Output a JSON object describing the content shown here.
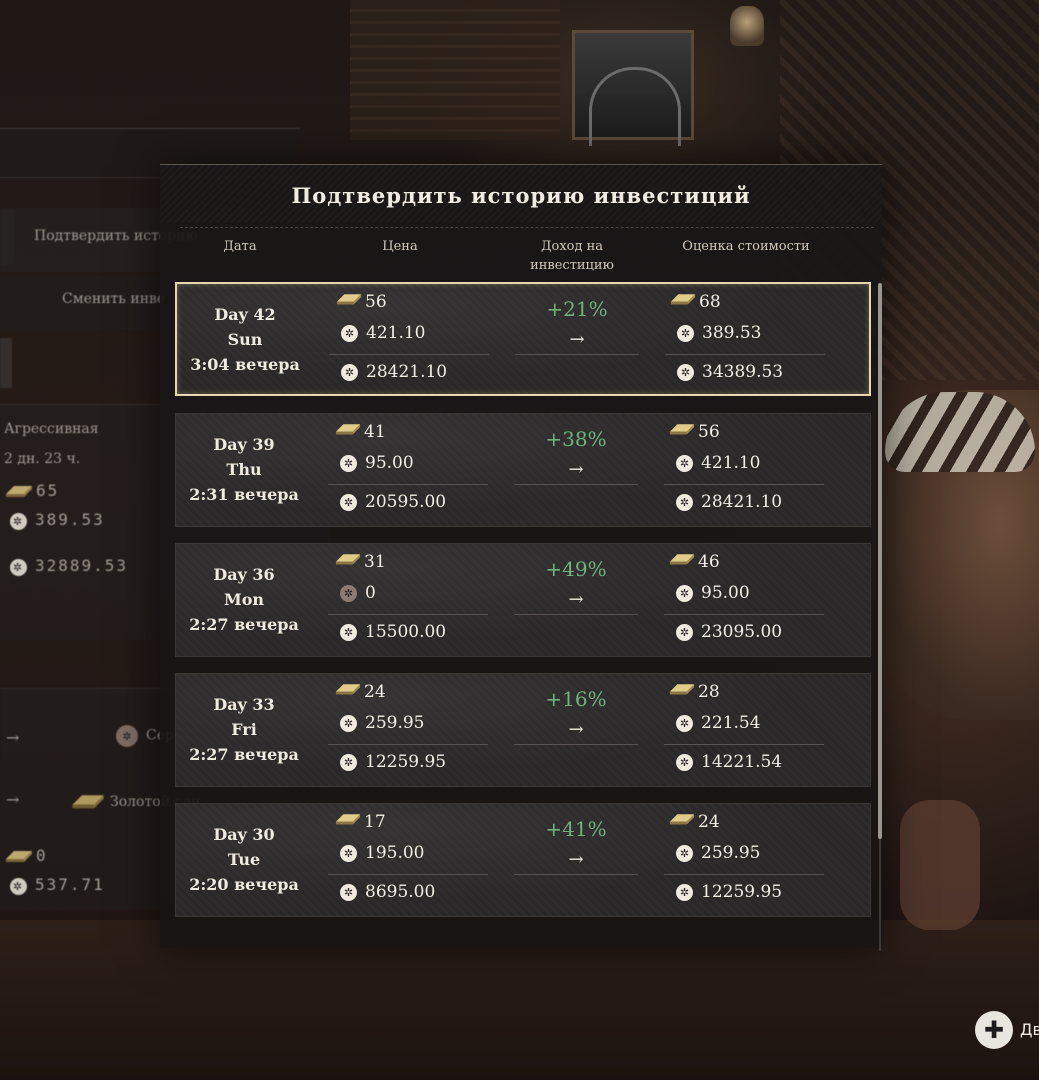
{
  "dialog": {
    "title": "Подтвердить историю инвестиций",
    "columns": {
      "date": "Дата",
      "price": "Цена",
      "roi_line1": "Доход на",
      "roi_line2": "инвестицию",
      "valuation": "Оценка стоимости"
    },
    "rows": [
      {
        "day": "Day 42",
        "weekday": "Sun",
        "time": "3:04 вечера",
        "gold_in": "56",
        "price_unit": "421.10",
        "price_total": "28421.10",
        "roi": "+21%",
        "arrow": "→",
        "gold_out": "68",
        "value_unit": "389.53",
        "value_total": "34389.53"
      },
      {
        "day": "Day 39",
        "weekday": "Thu",
        "time": "2:31 вечера",
        "gold_in": "41",
        "price_unit": "95.00",
        "price_total": "20595.00",
        "roi": "+38%",
        "arrow": "→",
        "gold_out": "56",
        "value_unit": "421.10",
        "value_total": "28421.10"
      },
      {
        "day": "Day 36",
        "weekday": "Mon",
        "time": "2:27 вечера",
        "gold_in": "31",
        "price_unit": "0",
        "price_total": "15500.00",
        "roi": "+49%",
        "arrow": "→",
        "gold_out": "46",
        "value_unit": "95.00",
        "value_total": "23095.00"
      },
      {
        "day": "Day 33",
        "weekday": "Fri",
        "time": "2:27 вечера",
        "gold_in": "24",
        "price_unit": "259.95",
        "price_total": "12259.95",
        "roi": "+16%",
        "arrow": "→",
        "gold_out": "28",
        "value_unit": "221.54",
        "value_total": "14221.54"
      },
      {
        "day": "Day 30",
        "weekday": "Tue",
        "time": "2:20 вечера",
        "gold_in": "17",
        "price_unit": "195.00",
        "price_total": "8695.00",
        "roi": "+41%",
        "arrow": "→",
        "gold_out": "24",
        "value_unit": "259.95",
        "value_total": "12259.95"
      }
    ]
  },
  "side_panel": {
    "confirm_history": "Подтвердить историю",
    "change_investment": "Сменить инве",
    "strategy": "Агрессивная",
    "time_left": "2 дн. 23 ч.",
    "gold_amount": "65",
    "unit_price": "389.53",
    "total_value": "32889.53",
    "arrow1": "→",
    "silver_label": "Сер",
    "arrow2": "→",
    "gold_label": "Золотой сли",
    "gold_zero": "0",
    "price2": "537.71"
  },
  "footer": {
    "control_label": "Дв"
  },
  "colors": {
    "accent_positive": "#6fb27b",
    "selected_border": "#e6d8ac"
  },
  "icons": {
    "gold": "gold-bar-icon",
    "coin": "coin-icon",
    "controller": "dpad-icon"
  }
}
